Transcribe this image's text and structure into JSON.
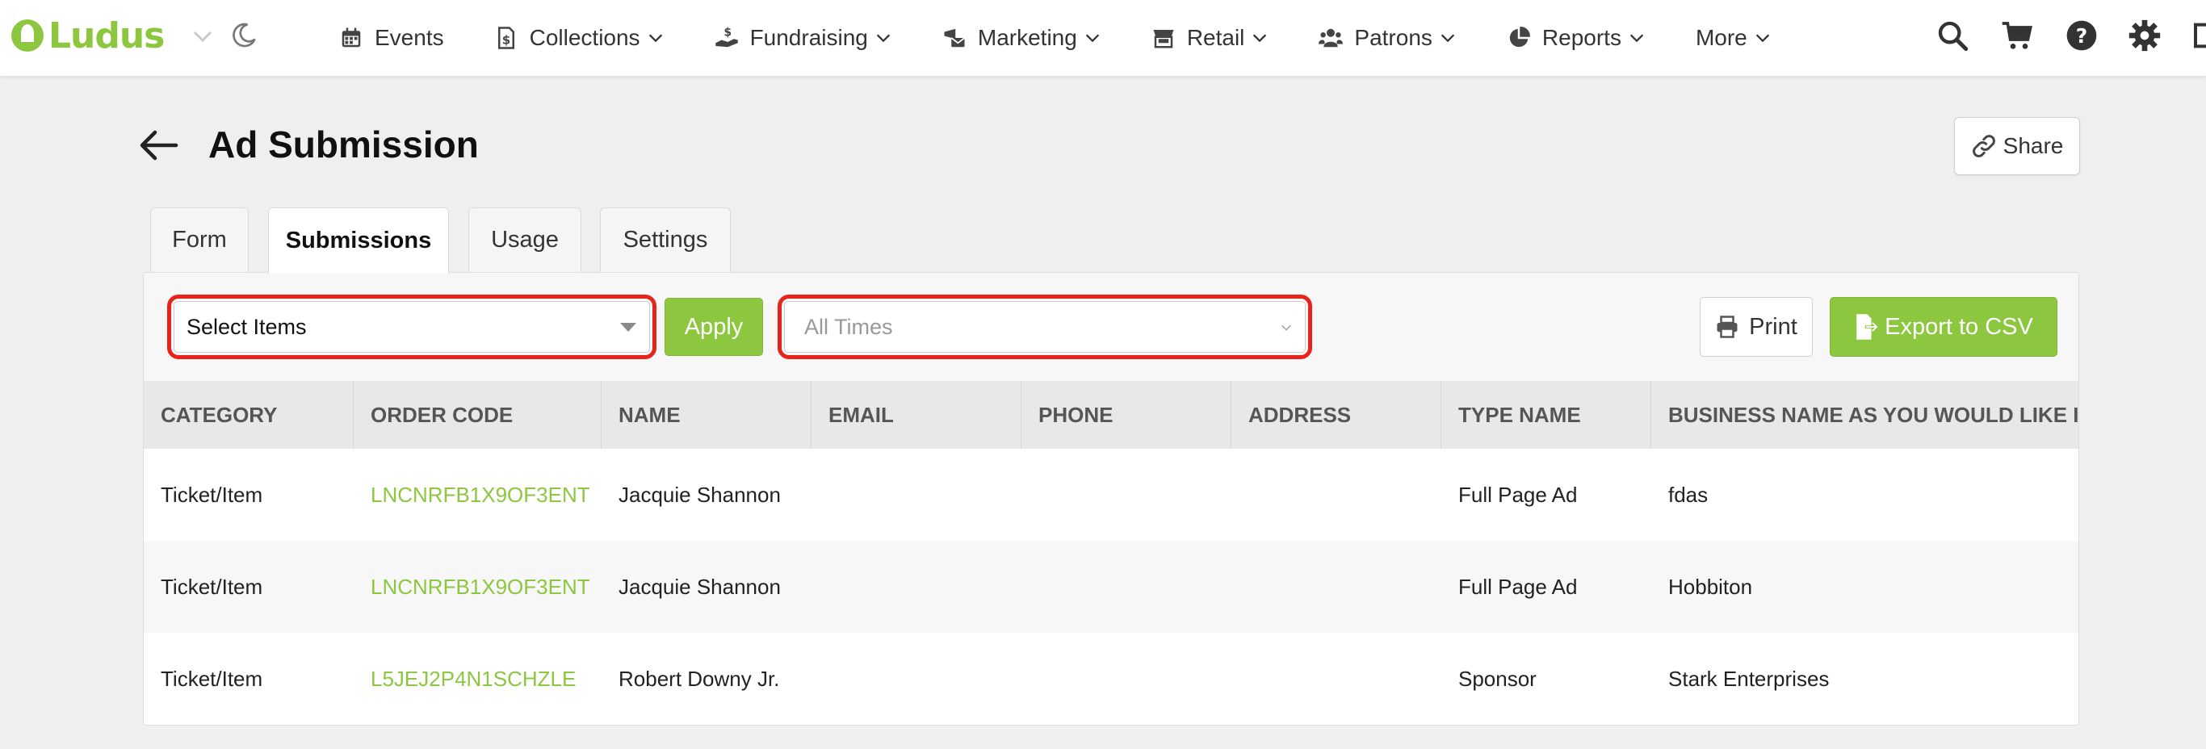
{
  "app": {
    "brand": "Ludus",
    "colors": {
      "accent": "#8dc63f",
      "highlight": "#e8231b"
    }
  },
  "nav": {
    "items": [
      {
        "label": "Events",
        "icon": "calendar-icon",
        "dropdown": false
      },
      {
        "label": "Collections",
        "icon": "receipt-dollar-icon",
        "dropdown": true
      },
      {
        "label": "Fundraising",
        "icon": "donate-hand-icon",
        "dropdown": true
      },
      {
        "label": "Marketing",
        "icon": "mail-bullhorn-icon",
        "dropdown": true
      },
      {
        "label": "Retail",
        "icon": "store-icon",
        "dropdown": true
      },
      {
        "label": "Patrons",
        "icon": "users-icon",
        "dropdown": true
      },
      {
        "label": "Reports",
        "icon": "pie-chart-icon",
        "dropdown": true
      },
      {
        "label": "More",
        "icon": "",
        "dropdown": true
      }
    ]
  },
  "page": {
    "title": "Ad Submission",
    "share_label": "Share",
    "tabs": [
      {
        "label": "Form",
        "active": false
      },
      {
        "label": "Submissions",
        "active": true
      },
      {
        "label": "Usage",
        "active": false
      },
      {
        "label": "Settings",
        "active": false
      }
    ]
  },
  "toolbar": {
    "items_select_value": "Select Items",
    "apply_label": "Apply",
    "time_select_value": "All Times",
    "print_label": "Print",
    "export_label": "Export to CSV"
  },
  "table": {
    "columns": [
      "CATEGORY",
      "ORDER CODE",
      "NAME",
      "EMAIL",
      "PHONE",
      "ADDRESS",
      "TYPE NAME",
      "BUSINESS NAME AS YOU WOULD LIKE IT"
    ],
    "rows": [
      [
        "Ticket/Item",
        "LNCNRFB1X9OF3ENT",
        "Jacquie Shannon",
        "",
        "",
        "",
        "Full Page Ad",
        "fdas"
      ],
      [
        "Ticket/Item",
        "LNCNRFB1X9OF3ENT",
        "Jacquie Shannon",
        "",
        "",
        "",
        "Full Page Ad",
        "Hobbiton"
      ],
      [
        "Ticket/Item",
        "L5JEJ2P4N1SCHZLE",
        "Robert Downy Jr.",
        "",
        "",
        "",
        "Sponsor",
        "Stark Enterprises"
      ]
    ]
  }
}
